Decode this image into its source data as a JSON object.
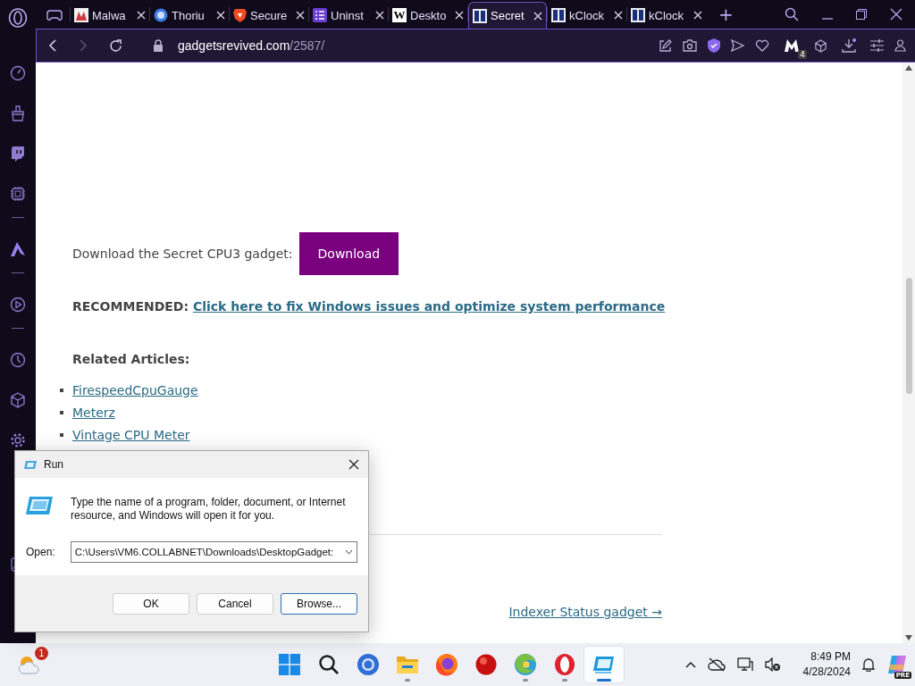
{
  "browser": {
    "tabs": [
      {
        "selected": false
      },
      {
        "label": "Malwa",
        "selected": false
      },
      {
        "label": "Thoriu",
        "selected": false
      },
      {
        "label": "Secure",
        "selected": false
      },
      {
        "label": "Uninst",
        "selected": false
      },
      {
        "label": "Deskto",
        "selected": false,
        "icon_text": "W"
      },
      {
        "label": "Secret",
        "selected": true
      },
      {
        "label": "kClock",
        "selected": false
      },
      {
        "label": "kClock",
        "selected": false
      }
    ],
    "new_tab": "+",
    "url_host": "gadgetsrevived.com",
    "url_path": "/2587/",
    "extension_badge": "4"
  },
  "page": {
    "download_label": "Download the Secret CPU3 gadget:",
    "download_button": "Download",
    "recommended_label": "RECOMMENDED:",
    "recommended_link": "Click here to fix Windows issues and optimize system performance",
    "related_heading": "Related Articles:",
    "related": [
      "FirespeedCpuGauge",
      "Meterz",
      "Vintage CPU Meter"
    ],
    "next_link": "Indexer Status gadget →"
  },
  "run_dialog": {
    "title": "Run",
    "description": "Type the name of a program, folder, document, or Internet resource, and Windows will open it for you.",
    "open_label": "Open:",
    "open_value": "C:\\Users\\VM6.COLLABNET\\Downloads\\DesktopGadget:",
    "buttons": [
      {
        "label": "OK",
        "focused": false
      },
      {
        "label": "Cancel",
        "focused": false
      },
      {
        "label": "Browse...",
        "focused": true
      }
    ]
  },
  "taskbar": {
    "weather_badge": "1",
    "apps": [
      {
        "running": false,
        "active": false
      },
      {
        "running": false,
        "active": false
      },
      {
        "running": false,
        "active": false
      },
      {
        "running": true,
        "active": false
      },
      {
        "running": false,
        "active": false
      },
      {
        "running": false,
        "active": false
      },
      {
        "running": true,
        "active": false
      },
      {
        "running": true,
        "active": false
      },
      {
        "running": true,
        "active": true
      }
    ],
    "time": "8:49 PM",
    "date": "4/28/2024",
    "copilot_badge": "PRE"
  }
}
